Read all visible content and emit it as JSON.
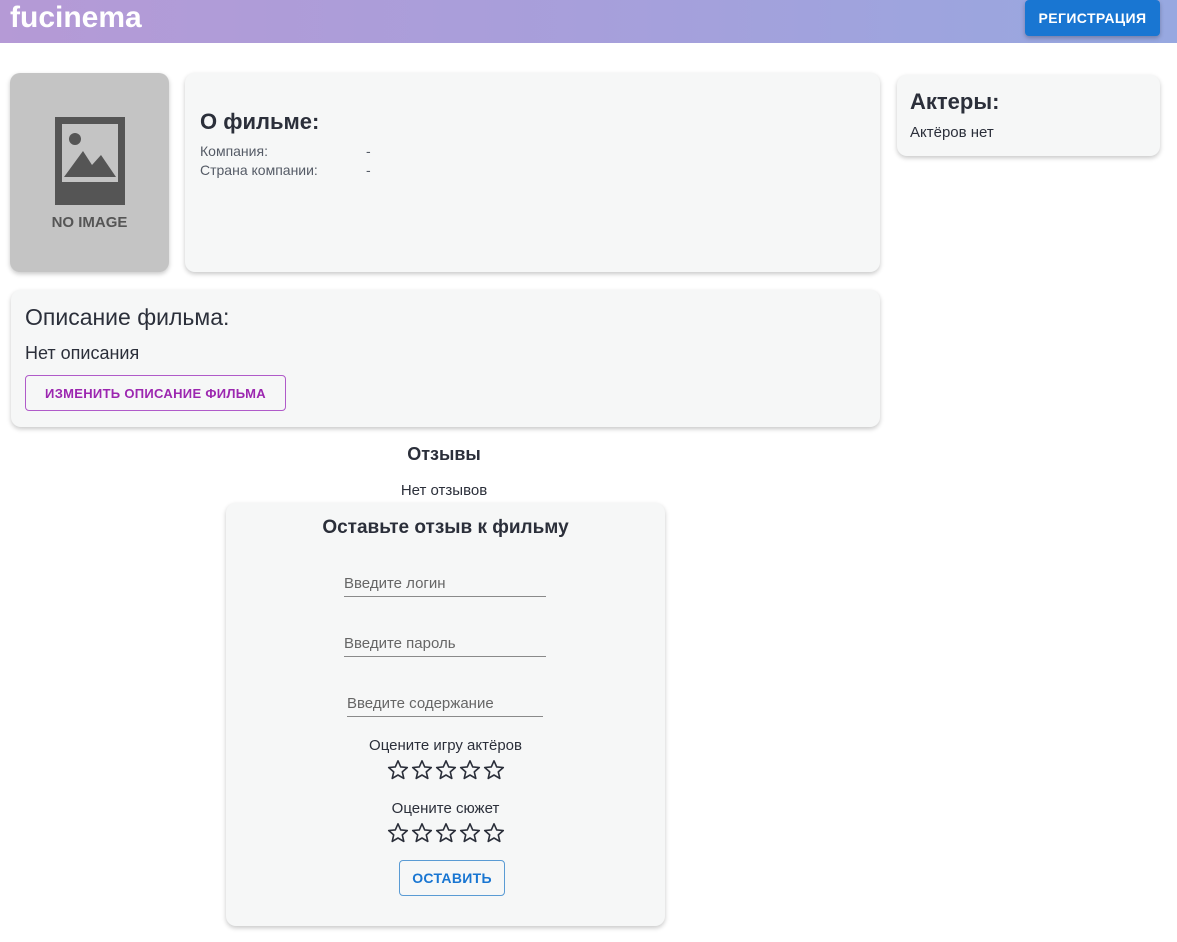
{
  "header": {
    "logo": "fucinema",
    "register_label": "РЕГИСТРАЦИЯ"
  },
  "poster": {
    "placeholder_text": "NO IMAGE",
    "icon": "image-placeholder-icon"
  },
  "about": {
    "title": "О фильме:",
    "rows": [
      {
        "label": "Компания:",
        "value": "-"
      },
      {
        "label": "Страна компании:",
        "value": "-"
      }
    ]
  },
  "actors": {
    "title": "Актеры:",
    "empty_text": "Актёров нет"
  },
  "description": {
    "title": "Описание фильма:",
    "text": "Нет описания",
    "edit_label": "ИЗМЕНИТЬ ОПИСАНИЕ ФИЛЬМА"
  },
  "reviews": {
    "title": "Отзывы",
    "empty_text": "Нет отзывов"
  },
  "review_form": {
    "title": "Оставьте отзыв к фильму",
    "login_placeholder": "Введите логин",
    "password_placeholder": "Введите пароль",
    "content_placeholder": "Введите содержание",
    "acting_label": "Оцените игру актёров",
    "acting_rating": 0,
    "plot_label": "Оцените сюжет",
    "plot_rating": 0,
    "max_rating": 5,
    "submit_label": "ОСТАВИТЬ"
  },
  "colors": {
    "primary": "#1976d2",
    "secondary": "#9c27b0",
    "header_gradient_start": "#b59ad6",
    "header_gradient_end": "#97a8e0"
  }
}
